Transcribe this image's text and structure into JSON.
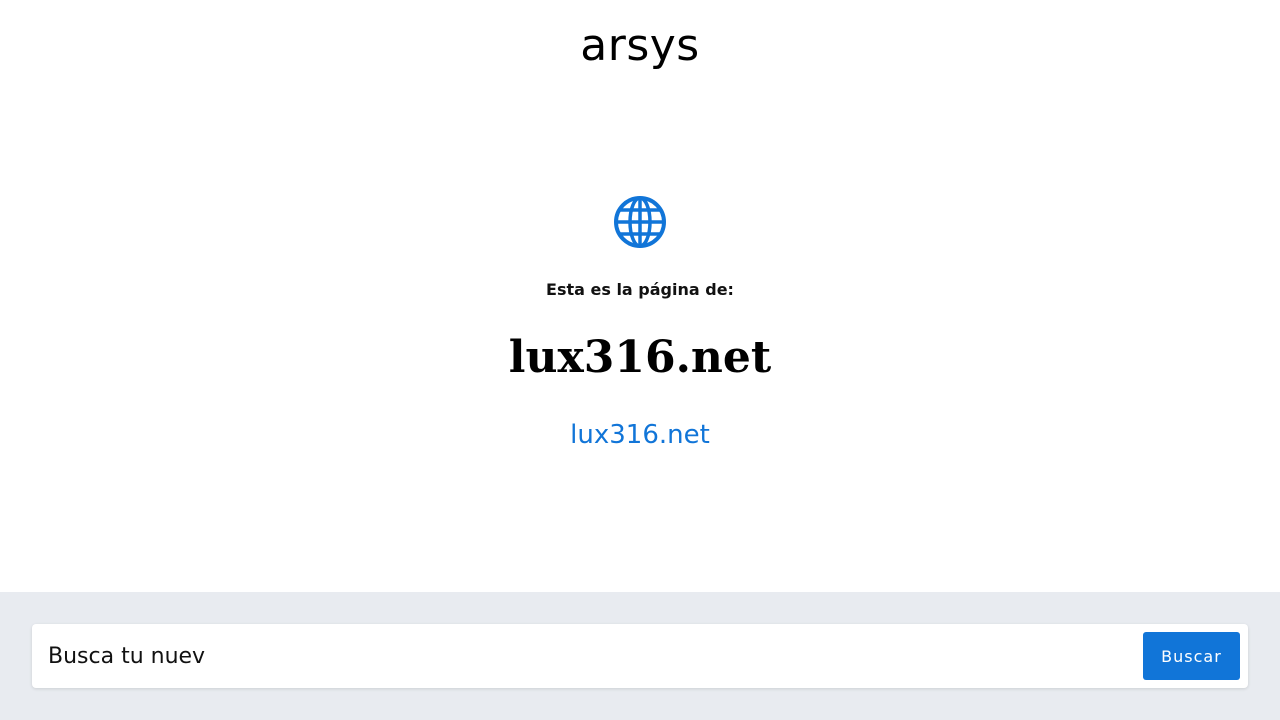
{
  "colors": {
    "accent": "#1175d8",
    "footer_bg": "#e8ebf0"
  },
  "header": {
    "logo_text": "arsys"
  },
  "main": {
    "icon": "globe-icon",
    "intro": "Esta es la página de:",
    "domain_title": "lux316.net",
    "domain_link": "lux316.net"
  },
  "footer": {
    "search": {
      "value": "Busca tu nuev",
      "button_label": "Buscar"
    }
  }
}
